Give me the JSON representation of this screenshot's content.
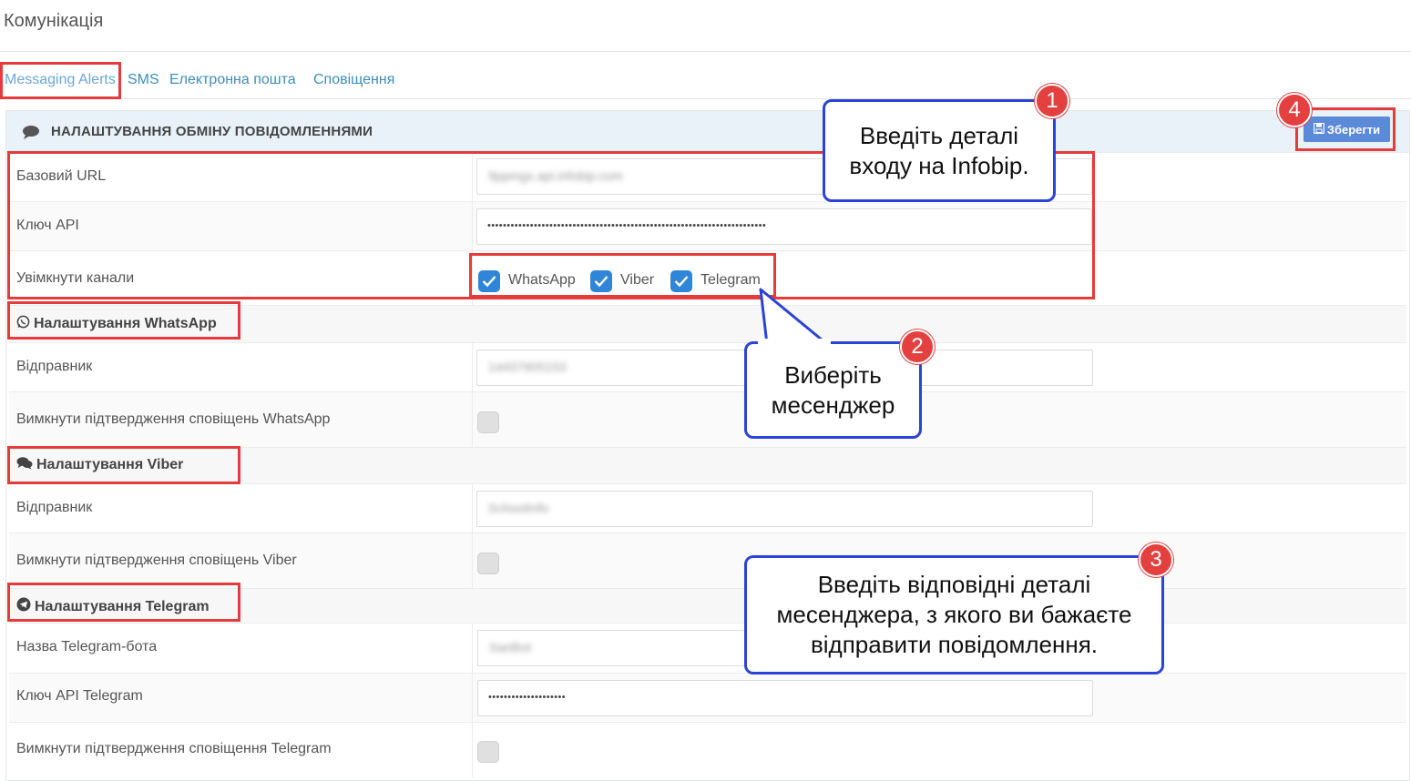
{
  "page": {
    "title": "Комунікація"
  },
  "tabs": [
    {
      "label": "Messaging Alerts"
    },
    {
      "label": "SMS"
    },
    {
      "label": "Електронна пошта"
    },
    {
      "label": "Сповіщення"
    }
  ],
  "panel": {
    "title": "НАЛАШТУВАННЯ ОБМІНУ ПОВІДОМЛЕННЯМИ",
    "save_label": "Зберегти"
  },
  "general": {
    "base_url_label": "Базовий URL",
    "base_url_value": "9ppmgx.api.infobip.com",
    "api_key_label": "Ключ API",
    "api_key_value": "••••••••••••••••••••••••••••••••••••••••••••••••••••••••••••••••••••••••",
    "channels_label": "Увімкнути канали",
    "channels": [
      {
        "label": "WhatsApp",
        "checked": true
      },
      {
        "label": "Viber",
        "checked": true
      },
      {
        "label": "Telegram",
        "checked": true
      }
    ]
  },
  "whatsapp": {
    "title": "Налаштування WhatsApp",
    "sender_label": "Відправник",
    "sender_value": "14437905153",
    "disable_label": "Вимкнути підтвердження сповіщень WhatsApp"
  },
  "viber": {
    "title": "Налаштування Viber",
    "sender_label": "Відправник",
    "sender_value": "SchoolInfo",
    "disable_label": "Вимкнути підтвердження сповіщень Viber"
  },
  "telegram": {
    "title": "Налаштування Telegram",
    "bot_label": "Назва Telegram-бота",
    "bot_value": "SanBot",
    "api_key_label": "Ключ API Telegram",
    "api_key_value": "••••••••••••••••••••",
    "disable_label": "Вимкнути підтвердження сповіщення Telegram"
  },
  "callouts": [
    {
      "number": "1",
      "text_line1": "Введіть деталі",
      "text_line2": "входу на Infobip."
    },
    {
      "number": "2",
      "text_line1": "Виберіть",
      "text_line2": "месенджер"
    },
    {
      "number": "3",
      "text_line1": "Введіть відповідні деталі",
      "text_line2": "месенджера, з якого ви бажаєте",
      "text_line3": "відправити повідомлення."
    },
    {
      "number": "4"
    }
  ],
  "colors": {
    "link": "#3c8dbc",
    "highlight": "#e53b3b",
    "callout_border": "#2b43d6",
    "badge": "#e44040",
    "save_button": "#5a8ad8",
    "checkbox_on": "#2f86d8"
  }
}
